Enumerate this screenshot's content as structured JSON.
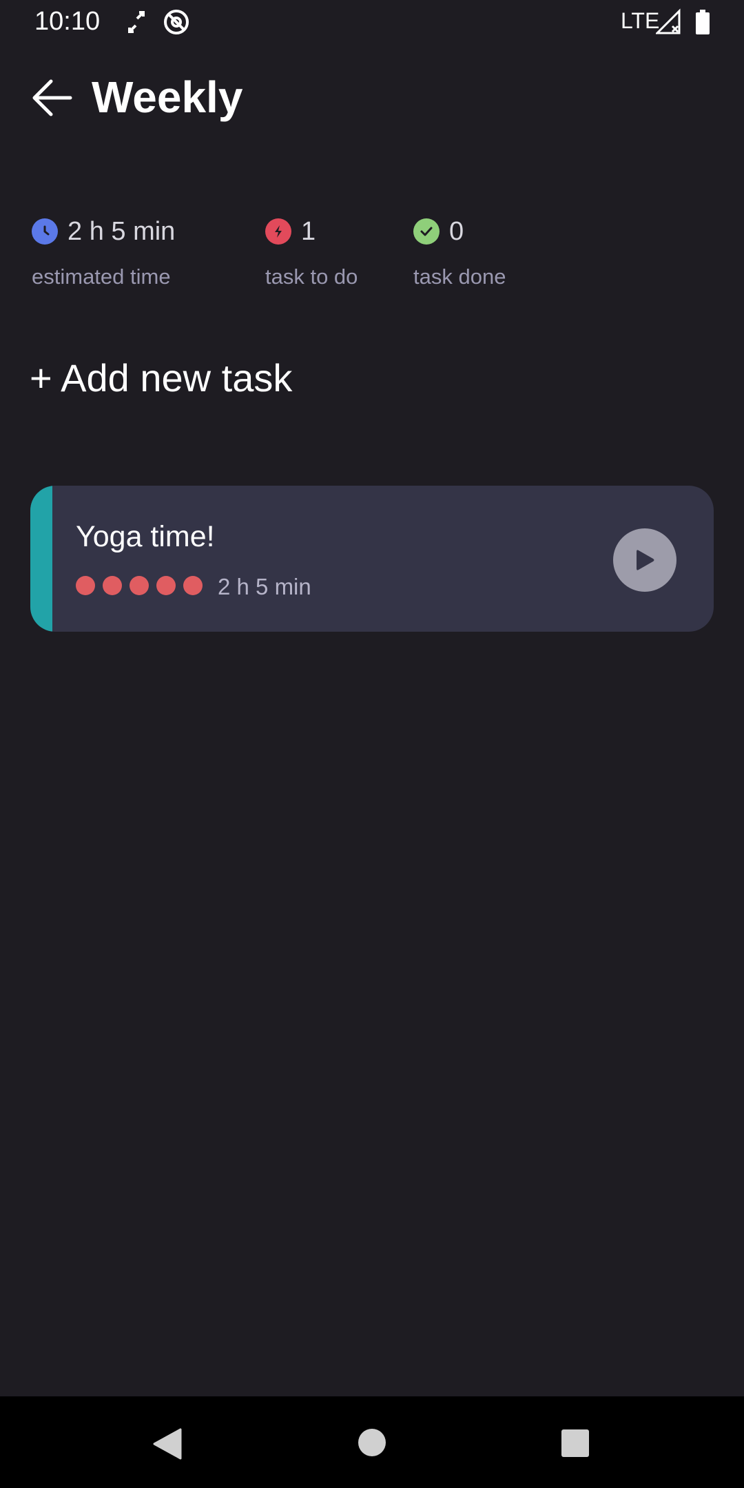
{
  "status_bar": {
    "time": "10:10",
    "network": "LTE",
    "icons": [
      "arrows-icon",
      "location-off-icon",
      "signal-icon",
      "battery-icon"
    ]
  },
  "header": {
    "back_icon": "arrow-left-icon",
    "title": "Weekly"
  },
  "stats": [
    {
      "icon": "clock-icon",
      "color": "#5b79e8",
      "value": "2 h 5 min",
      "label": "estimated time"
    },
    {
      "icon": "bolt-icon",
      "color": "#e24a5b",
      "value": "1",
      "label": "task to do"
    },
    {
      "icon": "check-icon",
      "color": "#8fcf7a",
      "value": "0",
      "label": "task done"
    }
  ],
  "add_task_label": "+ Add new task",
  "tasks": [
    {
      "title": "Yoga time!",
      "duration": "2 h 5 min",
      "dot_count": 5,
      "accent_color": "#22a3a8",
      "dot_color": "#e05d61"
    }
  ],
  "nav_bar": {
    "icons": [
      "nav-back-icon",
      "nav-home-icon",
      "nav-recents-icon"
    ]
  }
}
